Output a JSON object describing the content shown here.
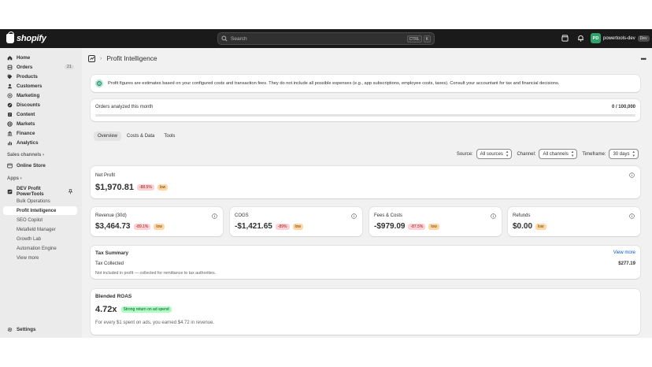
{
  "topbar": {
    "logo_text": "shopify",
    "search_placeholder": "Search",
    "search_key1": "CTRL",
    "search_key2": "K",
    "store_initials": "PD",
    "store_name": "powertools-dev",
    "store_tag": "Dev"
  },
  "sidebar": {
    "items": [
      {
        "label": "Home",
        "icon": "home-icon"
      },
      {
        "label": "Orders",
        "icon": "orders-icon",
        "count": "21"
      },
      {
        "label": "Products",
        "icon": "tag-icon"
      },
      {
        "label": "Customers",
        "icon": "person-icon"
      },
      {
        "label": "Marketing",
        "icon": "target-icon"
      },
      {
        "label": "Discounts",
        "icon": "discount-icon"
      },
      {
        "label": "Content",
        "icon": "content-icon"
      },
      {
        "label": "Markets",
        "icon": "globe-icon"
      },
      {
        "label": "Finance",
        "icon": "bank-icon"
      },
      {
        "label": "Analytics",
        "icon": "chart-icon"
      }
    ],
    "sales_channels_label": "Sales channels",
    "online_store": "Online Store",
    "apps_label": "Apps",
    "app_name": "DEV Profit PowerTools",
    "app_subitems": [
      "Bulk Operations",
      "Profit Intelligence",
      "SEO Copilot",
      "Metafield Manager",
      "Growth Lab",
      "Automation Engine",
      "View more"
    ],
    "settings": "Settings"
  },
  "page": {
    "title": "Profit Intelligence",
    "banner": "Profit figures are estimates based on your configured costs and transaction fees. They do not include all possible expenses (e.g., app subscriptions, employee costs, taxes). Consult your accountant for tax and financial decisions.",
    "orders_label": "Orders analyzed this month",
    "orders_value": "0 / 100,000",
    "orders_progress": 0,
    "tabs": [
      "Overview",
      "Costs & Data",
      "Tools"
    ],
    "filters": {
      "source_label": "Source:",
      "source_value": "All sources",
      "channel_label": "Channel:",
      "channel_value": "All channels",
      "timeframe_label": "Timeframe:",
      "timeframe_value": "30 days"
    },
    "net_profit": {
      "label": "Net Profit",
      "value": "$1,970.81",
      "change": "-88.5%",
      "badge": "low"
    },
    "metrics": [
      {
        "label": "Revenue (30d)",
        "value": "$3,464.73",
        "change": "-89.1%",
        "badge": "low"
      },
      {
        "label": "COGS",
        "value": "-$1,421.65",
        "change": "-89%",
        "badge": "low"
      },
      {
        "label": "Fees & Costs",
        "value": "-$979.09",
        "change": "-87.5%",
        "badge": "low"
      },
      {
        "label": "Refunds",
        "value": "$0.00",
        "badge": "low"
      }
    ],
    "tax": {
      "title": "Tax Summary",
      "view_more": "View more",
      "row_label": "Tax Collected",
      "row_value": "$277.19",
      "note": "Not included in profit — collected for remittance to tax authorities."
    },
    "roas": {
      "title": "Blended ROAS",
      "value": "4.72x",
      "badge": "Strong return on ad spend",
      "note": "For every $1 spent on ads, you earned $4.72 in revenue."
    }
  },
  "colors": {
    "topbar": "#1a1a1a",
    "link": "#005bd3",
    "success_badge": "#affebf",
    "critical_badge": "#fed1d7"
  }
}
